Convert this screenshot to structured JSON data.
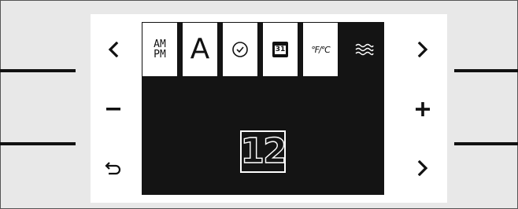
{
  "tabs": [
    {
      "id": "ampm",
      "label_top": "AM",
      "label_bottom": "PM",
      "icon": "am-pm-icon",
      "active": false
    },
    {
      "id": "font",
      "label": "A",
      "icon": "letter-a-icon",
      "active": false
    },
    {
      "id": "clock",
      "icon": "clock-icon",
      "active": false
    },
    {
      "id": "calendar",
      "label": "31",
      "icon": "calendar-icon",
      "active": false
    },
    {
      "id": "units",
      "label": "°F/°C",
      "icon": "temperature-unit-icon",
      "active": false
    },
    {
      "id": "water",
      "icon": "water-waves-icon",
      "active": true
    }
  ],
  "display": {
    "value": "12"
  },
  "controls": {
    "left": [
      "chevron-left-icon",
      "minus-icon",
      "back-icon"
    ],
    "right": [
      "chevron-right-icon",
      "plus-icon",
      "chevron-right-icon"
    ]
  },
  "colors": {
    "screen_background": "#141414",
    "panel_background": "#ffffff",
    "frame_background": "#e8e8e8",
    "ink": "#111111"
  }
}
